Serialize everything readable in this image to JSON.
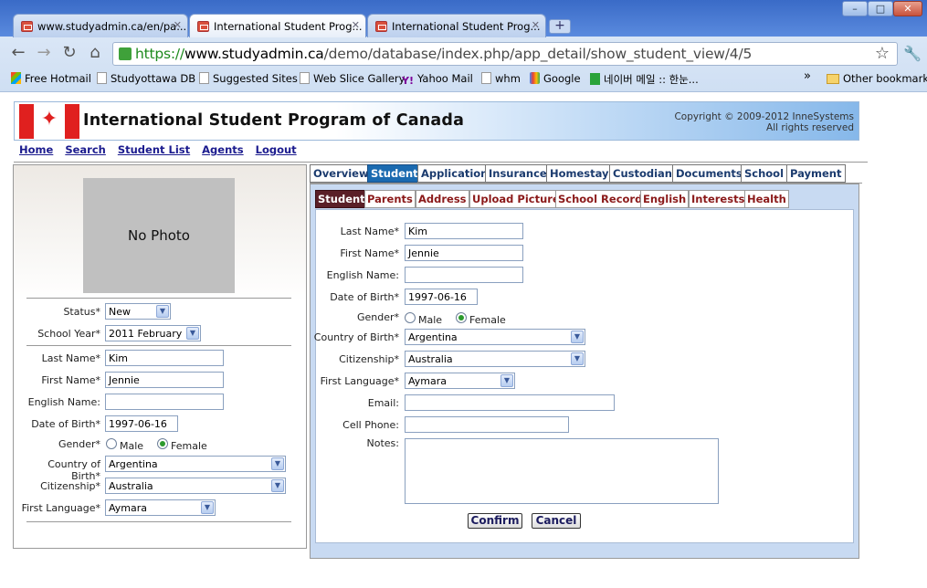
{
  "browser": {
    "tabs": [
      {
        "label": "www.studyadmin.ca/en/pa..."
      },
      {
        "label": "International Student Prog..."
      },
      {
        "label": "International Student Prog..."
      }
    ],
    "url_scheme": "https://",
    "url_host": "www.studyadmin.ca",
    "url_path": "/demo/database/index.php/app_detail/show_student_view/4/5",
    "bookmarks": [
      {
        "label": "Free Hotmail",
        "icon": "msn-icon"
      },
      {
        "label": "Studyottawa DB",
        "icon": "page-icon"
      },
      {
        "label": "Suggested Sites",
        "icon": "page-icon"
      },
      {
        "label": "Web Slice Gallery",
        "icon": "page-icon"
      },
      {
        "label": "Yahoo Mail",
        "icon": "yahoo-icon"
      },
      {
        "label": "whm",
        "icon": "page-icon"
      },
      {
        "label": "Google",
        "icon": "google-icon"
      },
      {
        "label": "네이버 메일 :: 한눈...",
        "icon": "naver-mail-icon"
      }
    ],
    "bookmarks_overflow": "»",
    "other_bookmarks": "Other bookmarks"
  },
  "site": {
    "title": "International Student Program of Canada",
    "copyright_line1": "Copyright © 2009-2012 InneSystems",
    "copyright_line2": "All rights reserved"
  },
  "nav": [
    "Home",
    "Search",
    "Student List",
    "Agents",
    "Logout"
  ],
  "left": {
    "photo_text": "No Photo",
    "status_label": "Status*",
    "status_value": "New",
    "school_year_label": "School Year*",
    "school_year_value": "2011 February",
    "last_name_label": "Last Name*",
    "last_name": "Kim",
    "first_name_label": "First Name*",
    "first_name": "Jennie",
    "english_name_label": "English Name:",
    "english_name": "",
    "dob_label": "Date of Birth*",
    "dob": "1997-06-16",
    "gender_label": "Gender*",
    "male_label": "Male",
    "female_label": "Female",
    "country_label": "Country of Birth*",
    "country": "Argentina",
    "citizenship_label": "Citizenship*",
    "citizenship": "Australia",
    "language_label": "First Language*",
    "language": "Aymara"
  },
  "top_tabs": [
    "Overview",
    "Student",
    "Application",
    "Insurance",
    "Homestay",
    "Custodian",
    "Documents",
    "School",
    "Payment"
  ],
  "sub_tabs": [
    "Student",
    "Parents",
    "Address",
    "Upload Picture",
    "School Record",
    "English",
    "Interests",
    "Health"
  ],
  "form": {
    "last_name_label": "Last Name*",
    "last_name": "Kim",
    "first_name_label": "First Name*",
    "first_name": "Jennie",
    "english_name_label": "English Name:",
    "english_name": "",
    "dob_label": "Date of Birth*",
    "dob": "1997-06-16",
    "gender_label": "Gender*",
    "male_label": "Male",
    "female_label": "Female",
    "country_label": "Country of Birth*",
    "country": "Argentina",
    "citizenship_label": "Citizenship*",
    "citizenship": "Australia",
    "language_label": "First Language*",
    "language": "Aymara",
    "email_label": "Email:",
    "email": "",
    "cell_label": "Cell Phone:",
    "cell": "",
    "notes_label": "Notes:",
    "confirm_label": "Confirm",
    "cancel_label": "Cancel"
  }
}
